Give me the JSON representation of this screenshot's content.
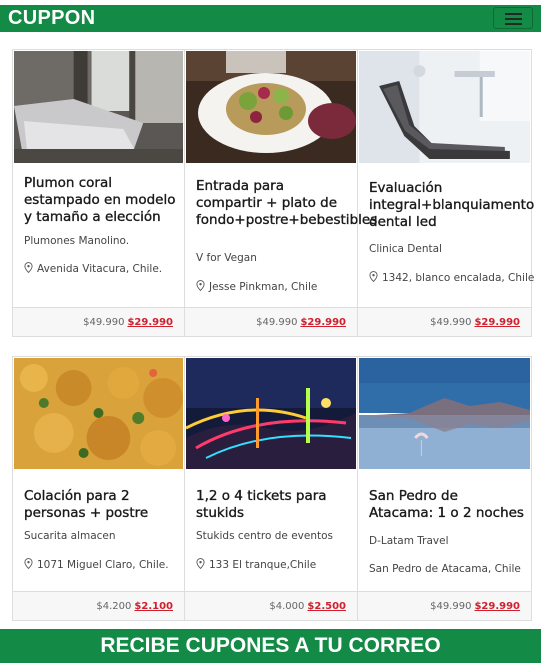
{
  "header": {
    "brand": "CUPPON",
    "menu_icon": "hamburger-icon",
    "color": "#138a45"
  },
  "deals": [
    {
      "image": "bedroom-photo",
      "title": "Plumon coral estampado en modelo y tamaño a elección",
      "merchant": "Plumones Manolino.",
      "address": "Avenida Vitacura, Chile.",
      "old_price": "$49.990",
      "new_price": "$29.990"
    },
    {
      "image": "salad-plate-photo",
      "title": "Entrada para compartir + plato de fondo+postre+bebestibles",
      "merchant": "V for Vegan",
      "address": "Jesse Pinkman, Chile",
      "old_price": "$49.990",
      "new_price": "$29.990"
    },
    {
      "image": "dental-chair-photo",
      "title": "Evaluación integral+blanquiamento dental led",
      "merchant": "Clinica Dental",
      "address": "1342, blanco encalada, Chile",
      "old_price": "$49.990",
      "new_price": "$29.990"
    },
    {
      "image": "lentil-dish-photo",
      "title": "Colación para 2 personas + postre",
      "merchant": "Sucarita almacen",
      "address": "1071 Miguel Claro, Chile.",
      "old_price": "$4.200",
      "new_price": "$2.100"
    },
    {
      "image": "carnival-night-photo",
      "title": "1,2 o 4 tickets para stukids",
      "merchant": "Stukids centro de eventos",
      "address": "133 El tranque,Chile",
      "old_price": "$4.000",
      "new_price": "$2.500"
    },
    {
      "image": "flamingo-lake-photo",
      "title": "San Pedro de Atacama: 1 o 2 noches",
      "merchant": "D-Latam Travel",
      "address": "San Pedro de Atacama, Chile",
      "old_price": "$49.990",
      "new_price": "$29.990"
    }
  ],
  "newsletter": {
    "label": "RECIBE CUPONES A TU CORREO"
  },
  "colors": {
    "brand_green": "#138a45",
    "price_red": "#d0202d"
  }
}
